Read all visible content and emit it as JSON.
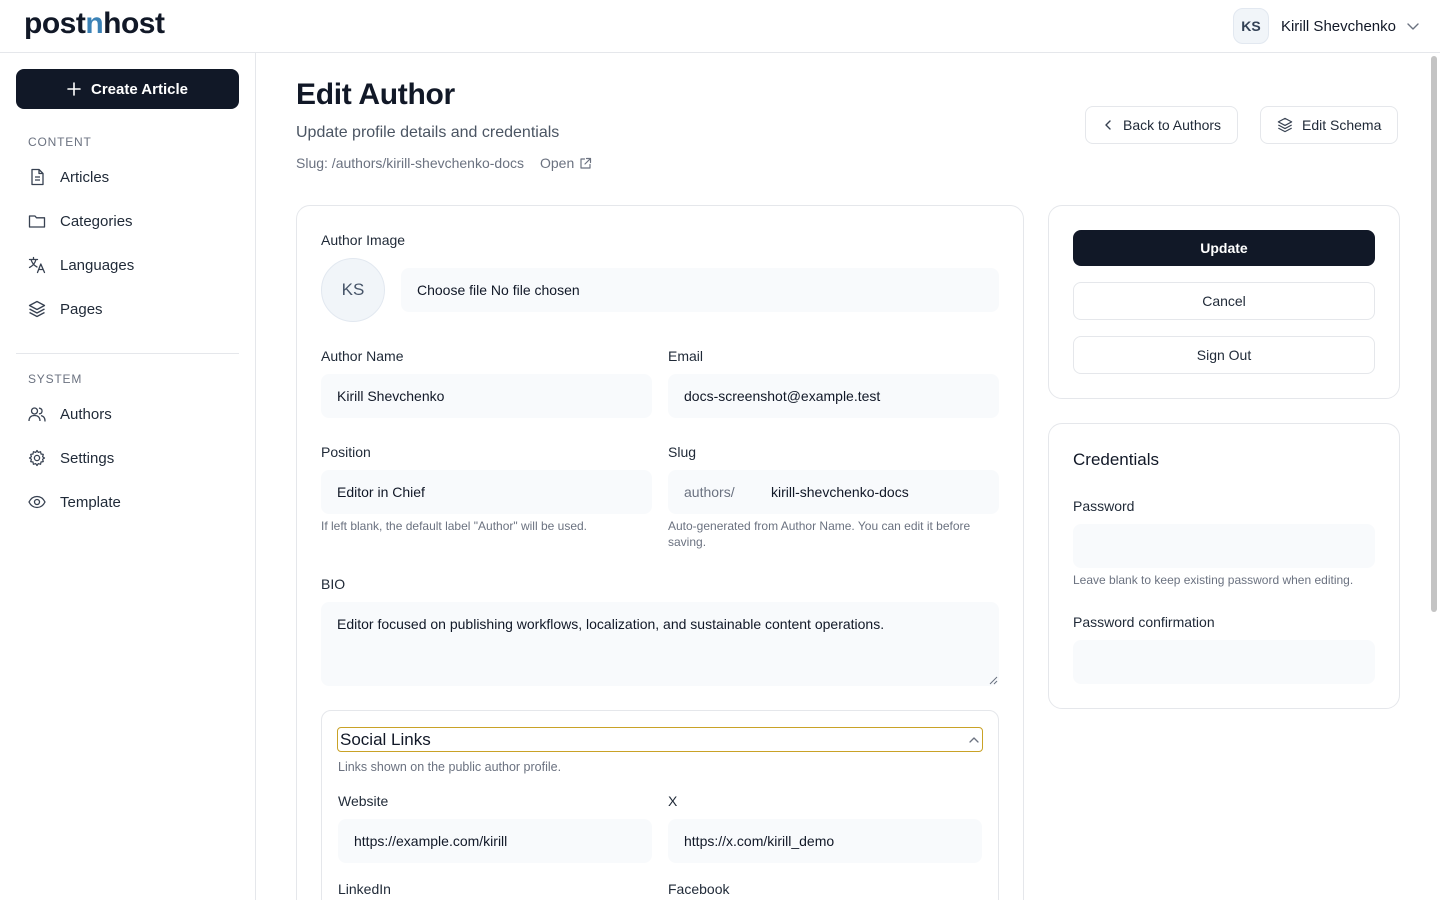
{
  "header": {
    "logo_part1": "post",
    "logo_accent": "n",
    "logo_part2": "host",
    "user_initials": "KS",
    "user_name": "Kirill Shevchenko"
  },
  "sidebar": {
    "create_label": "Create Article",
    "content_label": "CONTENT",
    "content_items": [
      "Articles",
      "Categories",
      "Languages",
      "Pages"
    ],
    "system_label": "SYSTEM",
    "system_items": [
      "Authors",
      "Settings",
      "Template"
    ]
  },
  "page": {
    "title": "Edit Author",
    "subtitle": "Update profile details and credentials",
    "slug_text": "Slug: /authors/kirill-shevchenko-docs",
    "open_label": "Open",
    "back_label": "Back to Authors",
    "schema_label": "Edit Schema"
  },
  "form": {
    "image_label": "Author Image",
    "avatar_initials": "KS",
    "file_text": "Choose file No file chosen",
    "name_label": "Author Name",
    "name_value": "Kirill Shevchenko",
    "email_label": "Email",
    "email_value": "docs-screenshot@example.test",
    "position_label": "Position",
    "position_value": "Editor in Chief",
    "position_hint": "If left blank, the default label \"Author\" will be used.",
    "slug_label": "Slug",
    "slug_prefix": "authors/",
    "slug_value": "kirill-shevchenko-docs",
    "slug_hint": "Auto-generated from Author Name. You can edit it before saving.",
    "bio_label": "BIO",
    "bio_value": "Editor focused on publishing workflows, localization, and sustainable content operations.",
    "social_title": "Social Links",
    "social_hint": "Links shown on the public author profile.",
    "website_label": "Website",
    "website_value": "https://example.com/kirill",
    "x_label": "X",
    "x_value": "https://x.com/kirill_demo",
    "linkedin_label": "LinkedIn",
    "facebook_label": "Facebook"
  },
  "actions": {
    "update": "Update",
    "cancel": "Cancel",
    "signout": "Sign Out"
  },
  "credentials": {
    "title": "Credentials",
    "password_label": "Password",
    "password_hint": "Leave blank to keep existing password when editing.",
    "confirm_label": "Password confirmation"
  },
  "colors": {
    "primary": "#111827",
    "accent": "#3b82b6",
    "focus": "#c9a227"
  }
}
